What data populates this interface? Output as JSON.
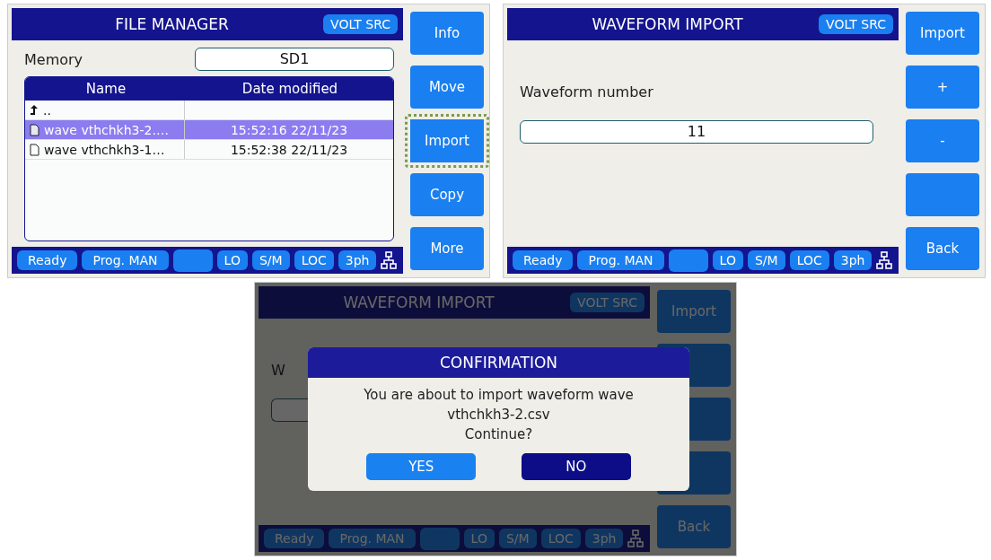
{
  "screens": [
    {
      "kind": "file_manager",
      "title": "FILE MANAGER",
      "mode": "VOLT SRC",
      "memory": {
        "label": "Memory",
        "value": "SD1"
      },
      "table": {
        "columns": [
          "Name",
          "Date modified"
        ],
        "rows": [
          {
            "kind": "parent",
            "name": "..",
            "selected": false
          },
          {
            "kind": "file",
            "name": "wave vthchkh3-2.…",
            "date": "15:52:16 22/11/23",
            "selected": true
          },
          {
            "kind": "file",
            "name": "wave vthchkh3-1…",
            "date": "15:52:38 22/11/23",
            "selected": false
          }
        ]
      },
      "softkeys": [
        {
          "label": "Info",
          "focused": false
        },
        {
          "label": "Move",
          "focused": false
        },
        {
          "label": "Import",
          "focused": true
        },
        {
          "label": "Copy",
          "focused": false
        },
        {
          "label": "More",
          "focused": false
        }
      ],
      "status": {
        "items": [
          "Ready",
          "Prog. MAN"
        ],
        "flags": [
          "LO",
          "S/M",
          "LOC",
          "3ph"
        ]
      }
    },
    {
      "kind": "waveform_import",
      "title": "WAVEFORM IMPORT",
      "mode": "VOLT SRC",
      "field": {
        "label": "Waveform number",
        "value": "11"
      },
      "softkeys": [
        {
          "label": "Import",
          "focused": false
        },
        {
          "label": "+",
          "focused": false
        },
        {
          "label": "-",
          "focused": false
        },
        {
          "focused": false
        },
        {
          "label": "Back",
          "focused": false
        }
      ],
      "status": {
        "items": [
          "Ready",
          "Prog. MAN"
        ],
        "flags": [
          "LO",
          "S/M",
          "LOC",
          "3ph"
        ]
      }
    },
    {
      "kind": "waveform_import",
      "dimmed": true,
      "title": "WAVEFORM IMPORT",
      "mode": "VOLT SRC",
      "field": {
        "label": "W"
      },
      "softkeys": [
        {
          "label": "Import"
        },
        {
          "label": "Back"
        }
      ],
      "status": {
        "items": [
          "Ready",
          "Prog. MAN"
        ],
        "flags": [
          "LO",
          "S/M",
          "LOC",
          "3ph"
        ]
      },
      "dialog": {
        "title": "CONFIRMATION",
        "message": [
          "You are about to import waveform wave",
          "vthchkh3-2.csv",
          "Continue?"
        ],
        "buttons": [
          {
            "label": "YES",
            "selected": false
          },
          {
            "label": "NO",
            "selected": true
          }
        ]
      }
    }
  ]
}
